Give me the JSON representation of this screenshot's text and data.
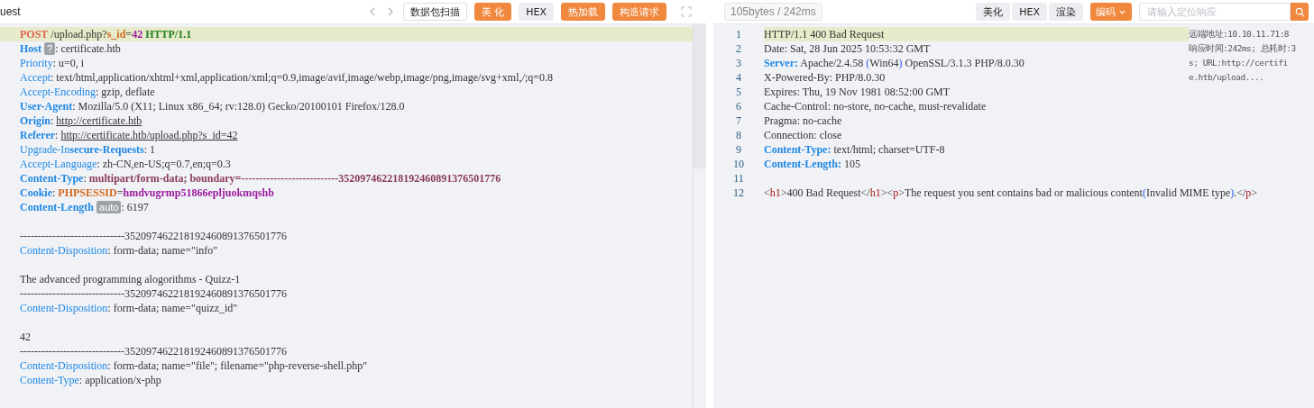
{
  "request": {
    "title": "uest",
    "buttons": [
      {
        "label": "数据包扫描",
        "kind": "outline"
      },
      {
        "label": "美 化",
        "kind": "orange"
      },
      {
        "label": "HEX",
        "kind": "plain"
      },
      {
        "label": "热加载",
        "kind": "orange"
      },
      {
        "label": "构造请求",
        "kind": "orange"
      }
    ],
    "lines": [
      {
        "highlighted": true,
        "segments": [
          {
            "kind": "method",
            "text": "POST"
          },
          {
            "kind": "text",
            "text": " /upload.php?"
          },
          {
            "kind": "param_key",
            "text": "s_id"
          },
          {
            "kind": "text",
            "text": "="
          },
          {
            "kind": "param_value",
            "text": "42"
          },
          {
            "kind": "version",
            "text": " HTTP/1.1"
          }
        ]
      },
      {
        "highlighted": false,
        "segments": [
          {
            "kind": "key_bold",
            "text": "Host"
          },
          {
            "kind": "badge",
            "text": "?"
          },
          {
            "kind": "text",
            "text": ": certificate.htb"
          }
        ]
      },
      {
        "highlighted": false,
        "segments": [
          {
            "kind": "key",
            "text": "Priority"
          },
          {
            "kind": "text",
            "text": ": u=0, i"
          }
        ]
      },
      {
        "highlighted": false,
        "segments": [
          {
            "kind": "key",
            "text": "Accept"
          },
          {
            "kind": "text",
            "text": ": text/html,application/xhtml+xml,application/xml;q=0.9,image/avif,image/webp,image/png,image/svg+xml,*/*;q=0.8"
          }
        ]
      },
      {
        "highlighted": false,
        "segments": [
          {
            "kind": "key",
            "text": "Accept-Encoding"
          },
          {
            "kind": "text",
            "text": ": gzip, deflate"
          }
        ]
      },
      {
        "highlighted": false,
        "segments": [
          {
            "kind": "key_bold",
            "text": "User-Agent"
          },
          {
            "kind": "text",
            "text": ": Mozilla/5.0 (X11; Linux x86_64; rv:128.0) Gecko/20100101 Firefox/128.0"
          }
        ]
      },
      {
        "highlighted": false,
        "segments": [
          {
            "kind": "key_bold",
            "text": "Origin"
          },
          {
            "kind": "text",
            "text": ": "
          },
          {
            "kind": "link",
            "text": "http://certificate.htb"
          }
        ]
      },
      {
        "highlighted": false,
        "segments": [
          {
            "kind": "key_bold",
            "text": "Referer"
          },
          {
            "kind": "text",
            "text": ": "
          },
          {
            "kind": "link",
            "text": "http://certificate.htb/upload.php?s_id=42"
          }
        ]
      },
      {
        "highlighted": false,
        "segments": [
          {
            "kind": "key",
            "text": "Upgrade-In**secure-Requests**"
          },
          {
            "kind": "text",
            "text": ": 1"
          }
        ]
      },
      {
        "highlighted": false,
        "segments": [
          {
            "kind": "key",
            "text": "Accept-Language"
          },
          {
            "kind": "text",
            "text": ": zh-CN,en-US;q=0.7,en;q=0.3"
          }
        ]
      },
      {
        "highlighted": false,
        "segments": [
          {
            "kind": "key_bold",
            "text": "Content-Type"
          },
          {
            "kind": "text",
            "text": ": "
          },
          {
            "kind": "boundary",
            "text": "multipart/form-data; boundary=---------------------------352097462218192460891376501776"
          }
        ]
      },
      {
        "highlighted": false,
        "segments": [
          {
            "kind": "key_bold",
            "text": "Cookie"
          },
          {
            "kind": "text",
            "text": ": "
          },
          {
            "kind": "param_key",
            "text": "PHPSESSID"
          },
          {
            "kind": "text",
            "text": "="
          },
          {
            "kind": "param_value",
            "text": "hmdvugrmp51866epljuokmqshb"
          }
        ]
      },
      {
        "highlighted": false,
        "segments": [
          {
            "kind": "key_bold",
            "text": "Content-Length"
          },
          {
            "kind": "badge",
            "text": "auto"
          },
          {
            "kind": "text",
            "text": ": 6197"
          }
        ]
      },
      {
        "highlighted": false
      },
      {
        "highlighted": false,
        "segments": [
          {
            "kind": "text",
            "text": "-----------------------------352097462218192460891376501776"
          }
        ]
      },
      {
        "highlighted": false,
        "segments": [
          {
            "kind": "key",
            "text": "Content-Disposition"
          },
          {
            "kind": "text",
            "text": ": form-data; name=\"info\""
          }
        ]
      },
      {
        "highlighted": false
      },
      {
        "highlighted": false,
        "segments": [
          {
            "kind": "text",
            "text": "The advanced programming alogorithms - Quizz-1"
          }
        ]
      },
      {
        "highlighted": false,
        "segments": [
          {
            "kind": "text",
            "text": "-----------------------------352097462218192460891376501776"
          }
        ]
      },
      {
        "highlighted": false,
        "segments": [
          {
            "kind": "key",
            "text": "Content-Disposition"
          },
          {
            "kind": "text",
            "text": ": form-data; name=\"quizz_id\""
          }
        ]
      },
      {
        "highlighted": false
      },
      {
        "highlighted": false,
        "segments": [
          {
            "kind": "text",
            "text": "42"
          }
        ]
      },
      {
        "highlighted": false,
        "segments": [
          {
            "kind": "text",
            "text": "-----------------------------352097462218192460891376501776"
          }
        ]
      },
      {
        "highlighted": false,
        "segments": [
          {
            "kind": "key",
            "text": "Content-Disposition"
          },
          {
            "kind": "text",
            "text": ": form-data; name=\"file\"; filename=\"php-reverse-shell.php\""
          }
        ]
      },
      {
        "highlighted": false,
        "segments": [
          {
            "kind": "key",
            "text": "Content-Type"
          },
          {
            "kind": "text",
            "text": ": application/x-php"
          }
        ]
      }
    ]
  },
  "response": {
    "stats": "105bytes / 242ms",
    "buttons": [
      {
        "label": "美化",
        "kind": "plain"
      },
      {
        "label": "HEX",
        "kind": "plain"
      },
      {
        "label": "渲染",
        "kind": "plain"
      }
    ],
    "encoding": {
      "label": "编码"
    },
    "search": {
      "placeholder": "请输入定位响应"
    },
    "lines": [
      {
        "number": "1",
        "highlighted": true,
        "segments": [
          {
            "kind": "text",
            "text": "HTTP/1.1 400 Bad Request"
          }
        ]
      },
      {
        "number": "2",
        "highlighted": false,
        "segments": [
          {
            "kind": "text",
            "text": "Date: Sat, 28 Jun 2025 10:53:32 GMT"
          }
        ]
      },
      {
        "number": "3",
        "highlighted": false,
        "segments": [
          {
            "kind": "key_bold",
            "text": "Server:"
          },
          {
            "kind": "text",
            "text": " Apache/2.4.58 "
          },
          {
            "kind": "paren",
            "text": "("
          },
          {
            "kind": "text",
            "text": "Win64"
          },
          {
            "kind": "paren",
            "text": ")"
          },
          {
            "kind": "text",
            "text": " OpenSSL/3.1.3 PHP/8.0.30"
          }
        ]
      },
      {
        "number": "4",
        "highlighted": false,
        "segments": [
          {
            "kind": "text",
            "text": "X-Powered-By: PHP/8.0.30"
          }
        ]
      },
      {
        "number": "5",
        "highlighted": false,
        "segments": [
          {
            "kind": "text",
            "text": "Expires: Thu, 19 Nov 1981 08:52:00 GMT"
          }
        ]
      },
      {
        "number": "6",
        "highlighted": false,
        "segments": [
          {
            "kind": "text",
            "text": "Cache-Control: no-store, no-cache, must-revalidate"
          }
        ]
      },
      {
        "number": "7",
        "highlighted": false,
        "segments": [
          {
            "kind": "text",
            "text": "Pragma: no-cache"
          }
        ]
      },
      {
        "number": "8",
        "highlighted": false,
        "segments": [
          {
            "kind": "text",
            "text": "Connection: close"
          }
        ]
      },
      {
        "number": "9",
        "highlighted": false,
        "segments": [
          {
            "kind": "key_bold",
            "text": "Content-Type:"
          },
          {
            "kind": "text",
            "text": " text/html; charset=UTF-8"
          }
        ]
      },
      {
        "number": "10",
        "highlighted": false,
        "segments": [
          {
            "kind": "key_bold",
            "text": "Content-Length:"
          },
          {
            "kind": "text",
            "text": " 105"
          }
        ]
      },
      {
        "number": "11",
        "highlighted": false
      },
      {
        "number": "12",
        "highlighted": false,
        "segments": [
          {
            "kind": "text",
            "text": "<"
          },
          {
            "kind": "tag",
            "text": "h1"
          },
          {
            "kind": "text",
            "text": ">400 Bad Request</"
          },
          {
            "kind": "tag",
            "text": "h1"
          },
          {
            "kind": "text",
            "text": "><"
          },
          {
            "kind": "tag",
            "text": "p"
          },
          {
            "kind": "text",
            "text": ">The request you sent contains bad or malicious content"
          },
          {
            "kind": "paren",
            "text": "("
          },
          {
            "kind": "text",
            "text": "Invalid MIME type"
          },
          {
            "kind": "paren",
            "text": ")"
          },
          {
            "kind": "text",
            "text": ".</"
          },
          {
            "kind": "tag",
            "text": "p"
          },
          {
            "kind": "text",
            "text": ">"
          }
        ]
      }
    ],
    "info": [
      "远端地址:10.10.11.71:8",
      "响应时间:242ms; 总耗时:3",
      "s; URL:http://certifi",
      "e.htb/upload...."
    ]
  }
}
